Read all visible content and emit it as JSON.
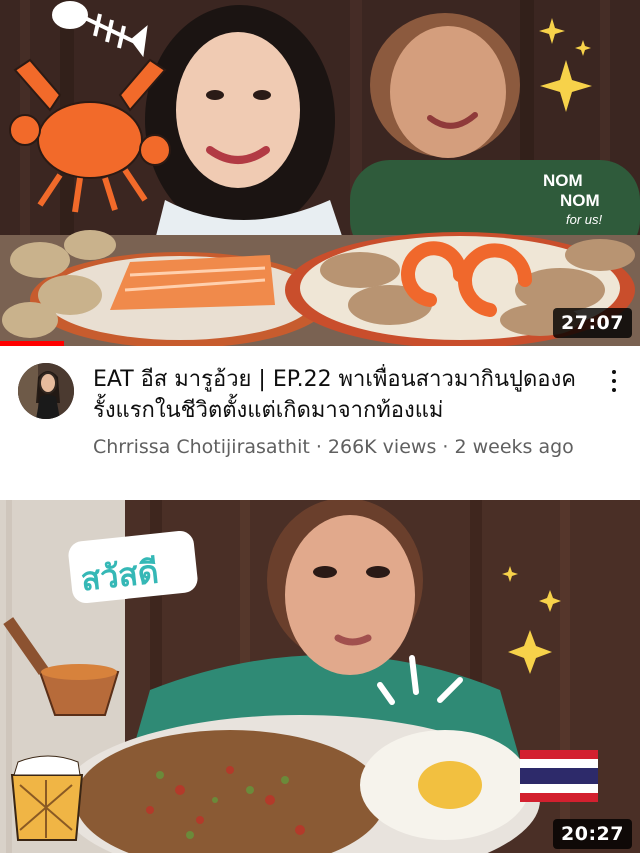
{
  "videos": [
    {
      "title": "EAT อีส มารูอ้วย | EP.22 พาเพื่อนสาวมากินปูดองครั้งแรกในชีวิตตั้งแต่เกิดมาจากท้องแม่",
      "channel": "Chrrissa Chotijirasathit",
      "views": "266K views",
      "age": "2 weeks ago",
      "separator": " · ",
      "duration": "27:07",
      "watch_progress": 0.1,
      "thumbnail_overlay_text": "NOM NOM for us!"
    },
    {
      "duration": "20:27",
      "thumbnail_overlay_text": "สวัสดี"
    }
  ],
  "icons": {
    "more": "more-vert-icon",
    "flag": "thailand-flag-icon"
  },
  "colors": {
    "progress": "#ff0000",
    "title": "#0f0f0f",
    "meta": "#606060"
  }
}
